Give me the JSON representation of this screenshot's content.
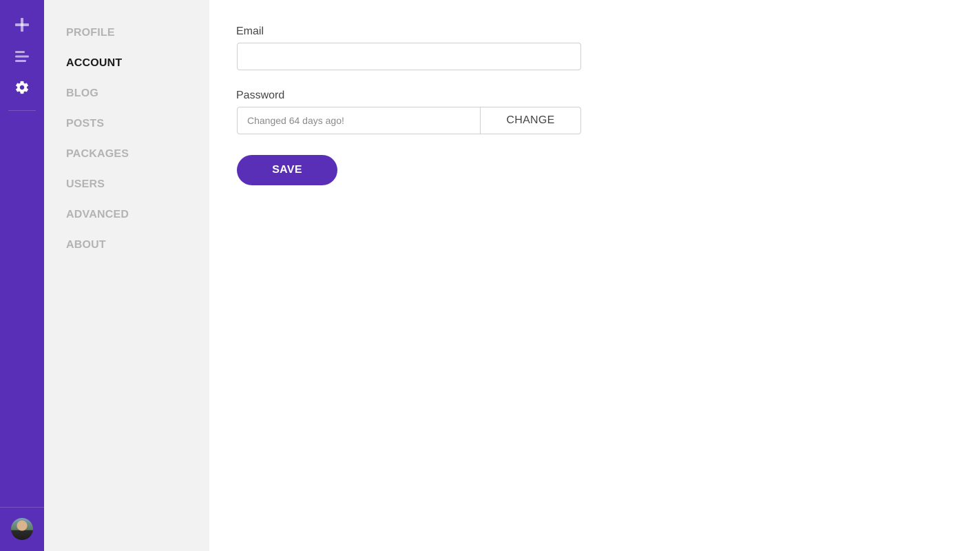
{
  "colors": {
    "accent": "#5a2fb8",
    "nav_background": "#f2f2f2",
    "nav_inactive": "#b3b3b3",
    "nav_active": "#1a1a1a"
  },
  "rail": {
    "icons": [
      "plus-icon",
      "list-icon",
      "gear-icon"
    ],
    "avatar": "user-avatar"
  },
  "nav": {
    "items": [
      {
        "label": "PROFILE",
        "active": false
      },
      {
        "label": "ACCOUNT",
        "active": true
      },
      {
        "label": "BLOG",
        "active": false
      },
      {
        "label": "POSTS",
        "active": false
      },
      {
        "label": "PACKAGES",
        "active": false
      },
      {
        "label": "USERS",
        "active": false
      },
      {
        "label": "ADVANCED",
        "active": false
      },
      {
        "label": "ABOUT",
        "active": false
      }
    ]
  },
  "form": {
    "email": {
      "label": "Email",
      "value": ""
    },
    "password": {
      "label": "Password",
      "status": "Changed 64 days ago!",
      "change_label": "CHANGE"
    },
    "save_label": "SAVE"
  }
}
